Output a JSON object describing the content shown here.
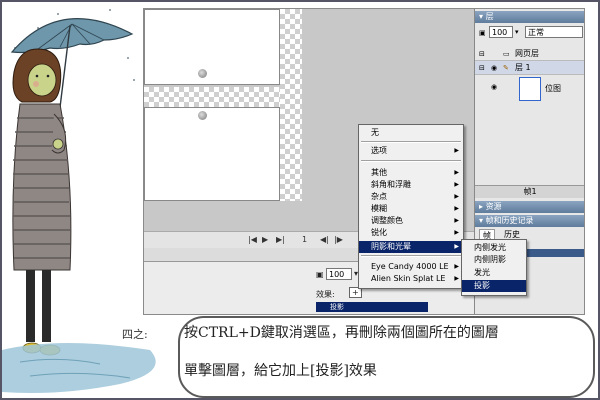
{
  "window": {
    "frame_number": "1",
    "zoom_value": "100",
    "effects_label": "效果:",
    "effect_item": "投影"
  },
  "layers_panel": {
    "title": "层",
    "opacity": "100",
    "blend_mode": "正常",
    "layer_web": "网页层",
    "layer_1": "层 1",
    "bitmap_label": "位图",
    "frames_tab": "帧1",
    "assets_title": "资源",
    "history_title": "帧和历史记录",
    "frames_label": "帧",
    "history_label": "历史"
  },
  "context_menu": {
    "items": [
      "无",
      "选项",
      "其他",
      "斜角和浮雕",
      "杂点",
      "模糊",
      "调整颜色",
      "锐化",
      "阴影和光晕",
      "Eye Candy 4000 LE",
      "Alien Skin Splat LE"
    ],
    "selected": "阴影和光晕"
  },
  "submenu": {
    "items": [
      "内侧发光",
      "内侧阴影",
      "发光",
      "投影"
    ],
    "selected": "投影"
  },
  "caption": {
    "step_label": "四之:",
    "line1": "按CTRL+D鍵取消選區，再刪除兩個圖所在的圖層",
    "line2": "單擊圖層，給它加上[投影]效果"
  },
  "colors": {
    "menu_highlight": "#0a246a",
    "panel_header": "#6b87a8",
    "background": "#ffffff"
  }
}
